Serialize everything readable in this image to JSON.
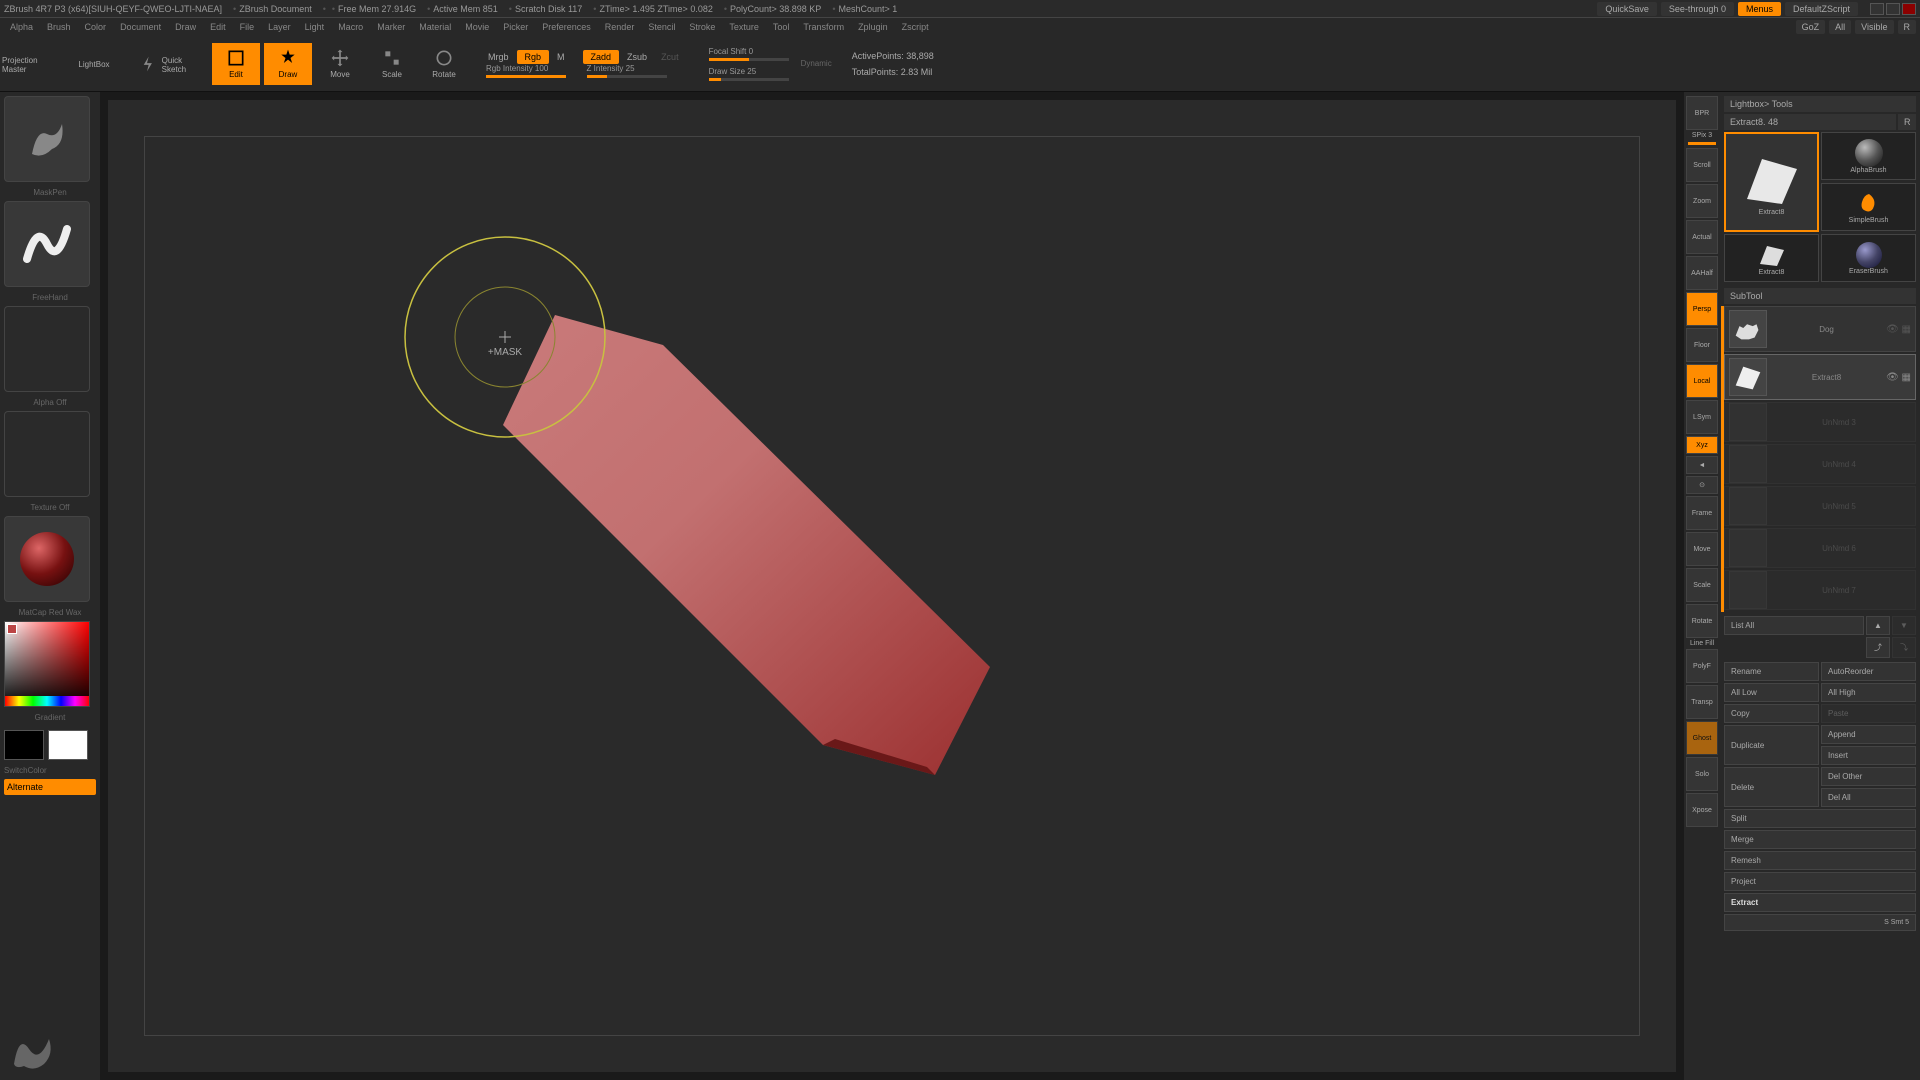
{
  "title": {
    "app": "ZBrush 4R7 P3 (x64)[SIUH-QEYF-QWEO-LJTI-NAEA]",
    "doc": "ZBrush Document",
    "freemem": "Free Mem 27.914G",
    "activemem": "Active Mem 851",
    "scratch": "Scratch Disk 117",
    "ztime": "ZTime> 1.495 ZTime> 0.082",
    "polycount": "PolyCount> 38.898 KP",
    "meshcount": "MeshCount> 1",
    "quicksave": "QuickSave",
    "seethrough": "See-through  0",
    "menus": "Menus",
    "defaultscript": "DefaultZScript"
  },
  "secondbar": {
    "goz": "GoZ",
    "all": "All",
    "visible": "Visible",
    "r": "R"
  },
  "menu": {
    "items": [
      "Alpha",
      "Brush",
      "Color",
      "Document",
      "Draw",
      "Edit",
      "File",
      "Layer",
      "Light",
      "Macro",
      "Marker",
      "Material",
      "Movie",
      "Picker",
      "Preferences",
      "Render",
      "Stencil",
      "Stroke",
      "Texture",
      "Tool",
      "Transform",
      "Zplugin",
      "Zscript"
    ]
  },
  "toolbar": {
    "projection": "Projection Master",
    "lightbox": "LightBox",
    "quicksketch": "Quick Sketch",
    "edit": "Edit",
    "draw": "Draw",
    "move": "Move",
    "scale": "Scale",
    "rotate": "Rotate",
    "mrgb": "Mrgb",
    "rgb": "Rgb",
    "m": "M",
    "rgb_intensity": "Rgb Intensity 100",
    "zadd": "Zadd",
    "zsub": "Zsub",
    "zcut": "Zcut",
    "z_intensity": "Z Intensity 25",
    "focal_shift": "Focal Shift 0",
    "draw_size": "Draw Size 25",
    "dynamic": "Dynamic",
    "activepoints": "ActivePoints: 38,898",
    "totalpoints": "TotalPoints: 2.83 Mil"
  },
  "left": {
    "brush": "MaskPen",
    "stroke": "FreeHand",
    "alpha": "Alpha Off",
    "texture": "Texture Off",
    "material": "MatCap Red Wax",
    "gradient": "Gradient",
    "switchcolor": "SwitchColor",
    "alternate": "Alternate"
  },
  "right_tools": {
    "bpr": "BPR",
    "spix": "SPix 3",
    "scroll": "Scroll",
    "zoom": "Zoom",
    "actual": "Actual",
    "aahalf": "AAHalf",
    "persp": "Persp",
    "floor": "Floor",
    "local": "Local",
    "lsym": "LSym",
    "xyz": "Xyz",
    "frame": "Frame",
    "move": "Move",
    "scale": "Scale",
    "rotate": "Rotate",
    "linefill": "Line Fill",
    "polyf": "PolyF",
    "transp": "Transp",
    "ghost": "Ghost",
    "solo": "Solo",
    "xpose": "Xpose"
  },
  "panel": {
    "lightbox_tools": "Lightbox> Tools",
    "extract_header": "Extract8. 48",
    "r": "R",
    "tools": {
      "extract8": "Extract8",
      "alphabrush": "AlphaBrush",
      "simplebrush": "SimpleBrush",
      "eraserbrush": "EraserBrush",
      "extract8b": "Extract8"
    },
    "subtool": "SubTool",
    "subtools": {
      "dog": "Dog",
      "extract8": "Extract8",
      "un3": "UnNmd 3",
      "un4": "UnNmd 4",
      "un5": "UnNmd 5",
      "un6": "UnNmd 6",
      "un7": "UnNmd 7"
    },
    "listall": "List All",
    "actions": {
      "rename": "Rename",
      "autoreorder": "AutoReorder",
      "alllow": "All Low",
      "allhigh": "All High",
      "copy": "Copy",
      "paste": "Paste",
      "duplicate": "Duplicate",
      "append": "Append",
      "insert": "Insert",
      "delete": "Delete",
      "delother": "Del Other",
      "delall": "Del All",
      "split": "Split",
      "merge": "Merge",
      "remesh": "Remesh",
      "project": "Project",
      "extract": "Extract",
      "ssmt": "S Smt 5"
    }
  },
  "cursor": {
    "label": "+MASK"
  }
}
